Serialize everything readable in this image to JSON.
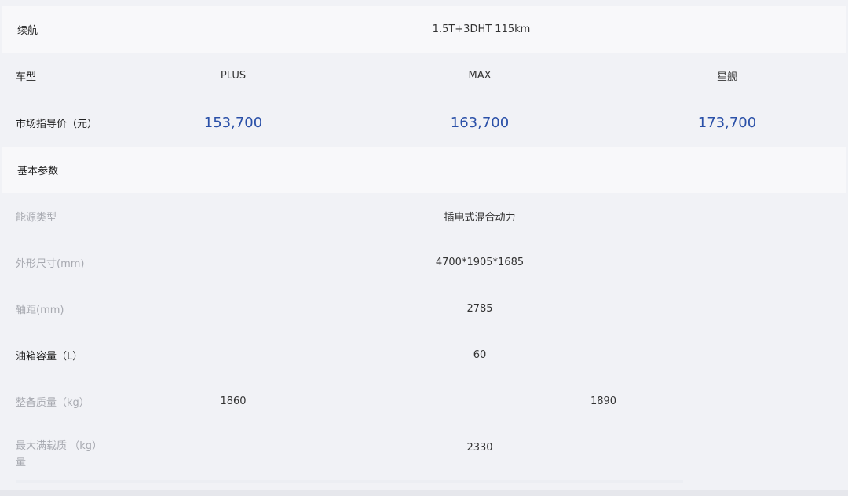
{
  "range_row": {
    "label": "续航",
    "value": "1.5T+3DHT 115km"
  },
  "model_row": {
    "label": "车型",
    "models": [
      "PLUS",
      "MAX",
      "星舰"
    ]
  },
  "price_row": {
    "label": "市场指导价（元）",
    "prices": [
      "153,700",
      "163,700",
      "173,700"
    ]
  },
  "section": {
    "title": "基本参数"
  },
  "specs": {
    "energy": {
      "label": "能源类型",
      "value": "插电式混合动力"
    },
    "dimensions": {
      "label": "外形尺寸(mm)",
      "value": "4700*1905*1685"
    },
    "wheelbase": {
      "label": "轴距(mm)",
      "value": "2785"
    },
    "fuel_tank": {
      "label": "油箱容量（L）",
      "value": "60"
    },
    "curb_weight": {
      "label": "整备质量（kg）",
      "values": [
        "1860",
        "1890"
      ]
    },
    "max_load_weight": {
      "label_line1": "最大满载质量",
      "label_line2": "（kg）",
      "value": "2330"
    }
  },
  "colors": {
    "price": "#2a50a8",
    "row_light": "#f8f8fa",
    "row_gray": "#f1f2f6",
    "muted_label": "#a7a9b0"
  }
}
